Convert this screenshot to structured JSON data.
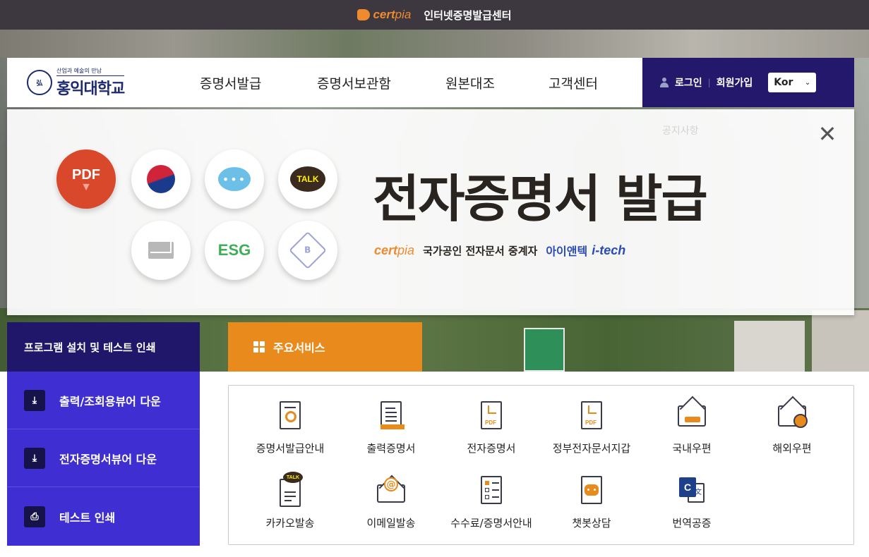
{
  "topbar": {
    "brand_cert": "cert",
    "brand_pia": "pia",
    "title": "인터넷증명발급센터"
  },
  "header": {
    "univ_slogan": "산업과 예술의 만남",
    "univ_name": "홍익대학교",
    "nav": [
      {
        "label": "증명서발급"
      },
      {
        "label": "증명서보관함"
      },
      {
        "label": "원본대조"
      },
      {
        "label": "고객센터"
      }
    ],
    "login": "로그인",
    "separator": "|",
    "signup": "회원가입",
    "language": "Kor",
    "accent_color": "#23186b"
  },
  "banner": {
    "close_symbol": "✕",
    "notice_ghost": "공지사항",
    "icons": {
      "pdf": "PDF",
      "pdf_arrow": "▼",
      "bubble": "•••",
      "talk": "TALK",
      "esg": "ESG",
      "chain": "B"
    },
    "title": "전자증명서 발급",
    "sub_brand_cert": "cert",
    "sub_brand_pia": "pia",
    "sub_text": "국가공인 전자문서 중계자",
    "partner_ko": "아이앤텍",
    "partner_en": "i-tech"
  },
  "left_panel": {
    "heading": "프로그램 설치 및 테스트 인쇄",
    "items": [
      {
        "label": "출력/조회용뷰어 다운",
        "icon_glyph": "⤓",
        "icon": "download-icon"
      },
      {
        "label": "전자증명서뷰어 다운",
        "icon_glyph": "⤓",
        "icon": "download-icon"
      },
      {
        "label": "테스트 인쇄",
        "icon_glyph": "⎙",
        "icon": "printer-icon"
      }
    ],
    "colors": {
      "heading_bg": "#20176a",
      "item_bg": "#3f2fd3"
    }
  },
  "services": {
    "tab_label": "주요서비스",
    "tab_color": "#e98a1d",
    "items": [
      {
        "label": "증명서발급안내",
        "icon": "certificate-search-icon",
        "pdf": ""
      },
      {
        "label": "출력증명서",
        "icon": "printed-document-icon",
        "pdf": ""
      },
      {
        "label": "전자증명서",
        "icon": "pdf-document-icon",
        "pdf": "PDF"
      },
      {
        "label": "정부전자문서지갑",
        "icon": "gov-wallet-pdf-icon",
        "pdf": "PDF"
      },
      {
        "label": "국내우편",
        "icon": "domestic-mail-icon",
        "pdf": ""
      },
      {
        "label": "해외우편",
        "icon": "international-mail-icon",
        "pdf": ""
      },
      {
        "label": "카카오발송",
        "icon": "kakao-talk-icon",
        "talk": "TALK"
      },
      {
        "label": "이메일발송",
        "icon": "email-icon",
        "at": "@"
      },
      {
        "label": "수수료/증명서안내",
        "icon": "fee-checklist-icon"
      },
      {
        "label": "챗봇상담",
        "icon": "chatbot-icon"
      },
      {
        "label": "번역공증",
        "icon": "translation-icon",
        "c": "C",
        "w": "文"
      }
    ]
  }
}
